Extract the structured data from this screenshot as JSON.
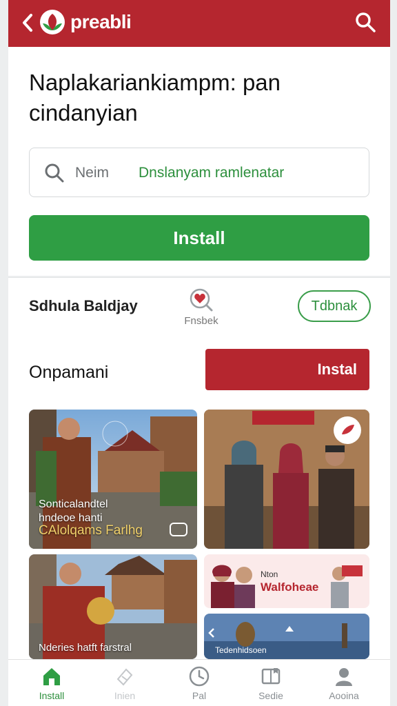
{
  "header": {
    "brand": "preabli",
    "colors": {
      "primary": "#b5262f",
      "accent": "#2f9e44"
    },
    "icons": {
      "back": "chevron-left-icon",
      "logo": "leaf-logo-icon",
      "search": "search-icon"
    }
  },
  "hero": {
    "headline": "Naplakariankiampm: pan cindanyian",
    "search": {
      "placeholder_prefix": "Neim",
      "placeholder_highlight": "Dnslanyam ramlenatar"
    },
    "install_label": "Install"
  },
  "row": {
    "title": "Sdhula Baldjay",
    "center_label": "Fnsbek",
    "pill_label": "Tdbnak"
  },
  "section": {
    "title": "Onpamani",
    "action_label": "Instal",
    "tiles": [
      {
        "caption_line1": "Sonticalandtel",
        "caption_line2": "hndeoe hanti",
        "caption_line3": "CAlolqams Farlhg"
      },
      {
        "banner": ""
      },
      {
        "caption": "Nderies hatft farstral"
      },
      {
        "small": "Nton",
        "big": "Walfoheae"
      },
      {
        "caption": "Tedenhidsoen"
      }
    ]
  },
  "bottom_nav": {
    "items": [
      {
        "label": "Install",
        "icon": "home-icon",
        "active": true
      },
      {
        "label": "Inien",
        "icon": "ticket-icon",
        "active": false
      },
      {
        "label": "Pal",
        "icon": "clock-icon",
        "active": false
      },
      {
        "label": "Sedie",
        "icon": "book-icon",
        "active": false
      },
      {
        "label": "Aooina",
        "icon": "person-icon",
        "active": false
      }
    ]
  }
}
